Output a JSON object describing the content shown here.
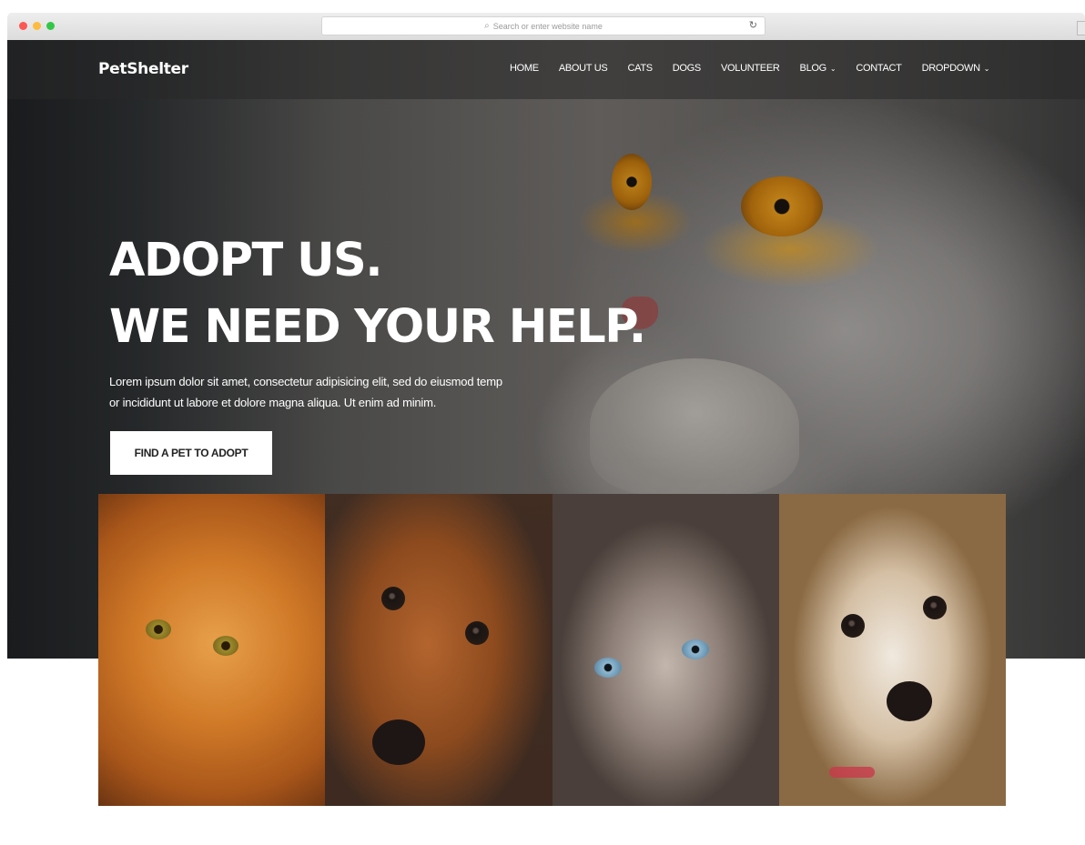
{
  "browser": {
    "url_placeholder": "Search or enter website name",
    "traffic_lights": [
      "#fc5753",
      "#fdbc40",
      "#33c748"
    ]
  },
  "navbar": {
    "brand": "PetShelter",
    "items": [
      {
        "label": "HOME"
      },
      {
        "label": "ABOUT US"
      },
      {
        "label": "CATS"
      },
      {
        "label": "DOGS"
      },
      {
        "label": "VOLUNTEER"
      },
      {
        "label": "BLOG",
        "caret": "⌄"
      },
      {
        "label": "CONTACT"
      },
      {
        "label": "DROPDOWN",
        "caret": "⌄"
      }
    ]
  },
  "hero": {
    "title_line1": "ADOPT US.",
    "title_line2": "WE NEED YOUR HELP.",
    "desc_line1": "Lorem ipsum dolor sit amet, consectetur adipisicing elit, sed do eiusmod temp",
    "desc_line2": "or incididunt ut labore et dolore magna aliqua. Ut enim ad minim.",
    "cta_label": "FIND A PET TO ADOPT"
  },
  "gallery": {
    "tiles": [
      "orange-cat-photo",
      "dachshund-photo",
      "persian-cat-photo",
      "shih-tzu-puppy-photo"
    ]
  }
}
